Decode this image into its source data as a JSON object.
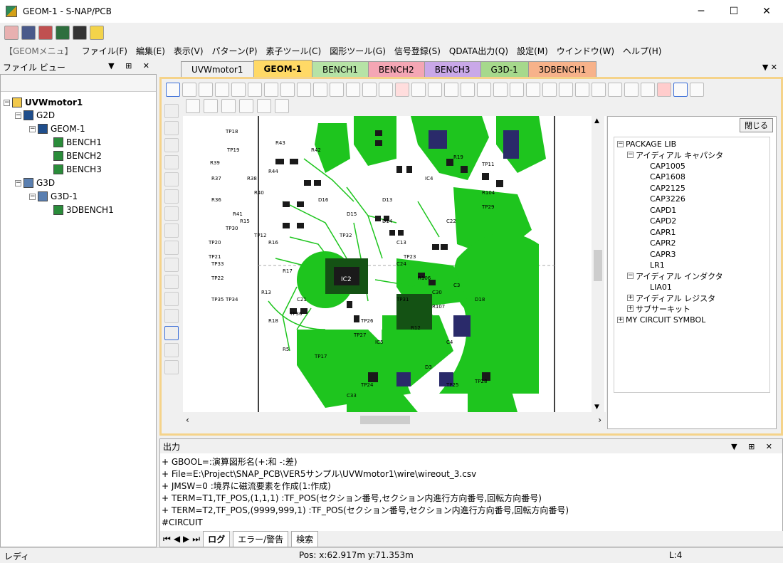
{
  "window": {
    "title": "GEOM-1 - S-NAP/PCB",
    "minimize": "─",
    "maximize": "☐",
    "close": "✕"
  },
  "menu": {
    "items": [
      "【GEOMメニュ】",
      "ファイル(F)",
      "編集(E)",
      "表示(V)",
      "パターン(P)",
      "素子ツール(C)",
      "図形ツール(G)",
      "信号登録(S)",
      "QDATA出力(Q)",
      "設定(M)",
      "ウインドウ(W)",
      "ヘルプ(H)"
    ]
  },
  "fileview": {
    "title": "ファイル ビュー",
    "tree": [
      {
        "label": "UVWmotor1",
        "bold": true
      },
      {
        "label": "G2D"
      },
      {
        "label": "GEOM-1"
      },
      {
        "label": "BENCH1"
      },
      {
        "label": "BENCH2"
      },
      {
        "label": "BENCH3"
      },
      {
        "label": "G3D"
      },
      {
        "label": "G3D-1"
      },
      {
        "label": "3DBENCH1"
      }
    ]
  },
  "tabs": [
    {
      "label": "UVWmotor1",
      "color": "#f0f0f0"
    },
    {
      "label": "GEOM-1",
      "color": "#ffd966"
    },
    {
      "label": "BENCH1",
      "color": "#b6e3a6"
    },
    {
      "label": "BENCH2",
      "color": "#f4a6b4"
    },
    {
      "label": "BENCH3",
      "color": "#c9a8e8"
    },
    {
      "label": "G3D-1",
      "color": "#a6d98c"
    },
    {
      "label": "3DBENCH1",
      "color": "#f7b28a"
    }
  ],
  "library": {
    "close_label": "閉じる",
    "items": [
      {
        "label": "PACKAGE LIB"
      },
      {
        "label": "アイディアル キャパシタ"
      },
      {
        "label": "CAP1005"
      },
      {
        "label": "CAP1608"
      },
      {
        "label": "CAP2125"
      },
      {
        "label": "CAP3226"
      },
      {
        "label": "CAPD1"
      },
      {
        "label": "CAPD2"
      },
      {
        "label": "CAPR1"
      },
      {
        "label": "CAPR2"
      },
      {
        "label": "CAPR3"
      },
      {
        "label": "LR1"
      },
      {
        "label": "アイディアル インダクタ"
      },
      {
        "label": "LIA01"
      },
      {
        "label": "アイディアル レジスタ"
      },
      {
        "label": "サブサーキット"
      },
      {
        "label": "MY CIRCUIT SYMBOL"
      }
    ]
  },
  "output": {
    "title": "出力",
    "lines": [
      "+ GBOOL=:演算図形名(+:和 -:差)",
      "+ File=E:\\Project\\SNAP_PCB\\VER5サンプル\\UVWmotor1\\wire\\wireout_3.csv",
      "+ JMSW=0 :境界に磁流要素を作成(1:作成)",
      "+ TERM=T1,TF_POS,(1,1,1) :TF_POS(セクション番号,セクション内進行方向番号,回転方向番号)",
      "+ TERM=T2,TF_POS,(9999,999,1) :TF_POS(セクション番号,セクション内進行方向番号,回転方向番号)",
      "#CIRCUIT"
    ],
    "tabs": [
      "ログ",
      "エラー/警告",
      "検索"
    ]
  },
  "status": {
    "ready": "レディ",
    "pos": "Pos: x:62.917m y:71.353m",
    "layer": "L:4"
  },
  "pcb": {
    "labels": [
      "TP18",
      "TP19",
      "TP17",
      "R39",
      "R43",
      "R42",
      "R38",
      "R44",
      "R37",
      "R40",
      "R41",
      "R36",
      "IC4",
      "IC2",
      "R5",
      "R104",
      "TP20",
      "TP21",
      "TP22",
      "TP23",
      "TP24",
      "TP25",
      "TP26",
      "TP27",
      "TP28",
      "D18",
      "D16",
      "D15",
      "D14",
      "D13",
      "C13",
      "C21",
      "C22",
      "C24",
      "C30",
      "C3",
      "C4",
      "R106",
      "R107",
      "R12",
      "R13",
      "R15",
      "R16",
      "R17",
      "R18",
      "R19",
      "IC5",
      "C33",
      "D3",
      "TP11",
      "TP12",
      "TP29",
      "TP30",
      "TP31",
      "TP32",
      "TP33",
      "TP34",
      "TP35",
      "TP36"
    ]
  }
}
